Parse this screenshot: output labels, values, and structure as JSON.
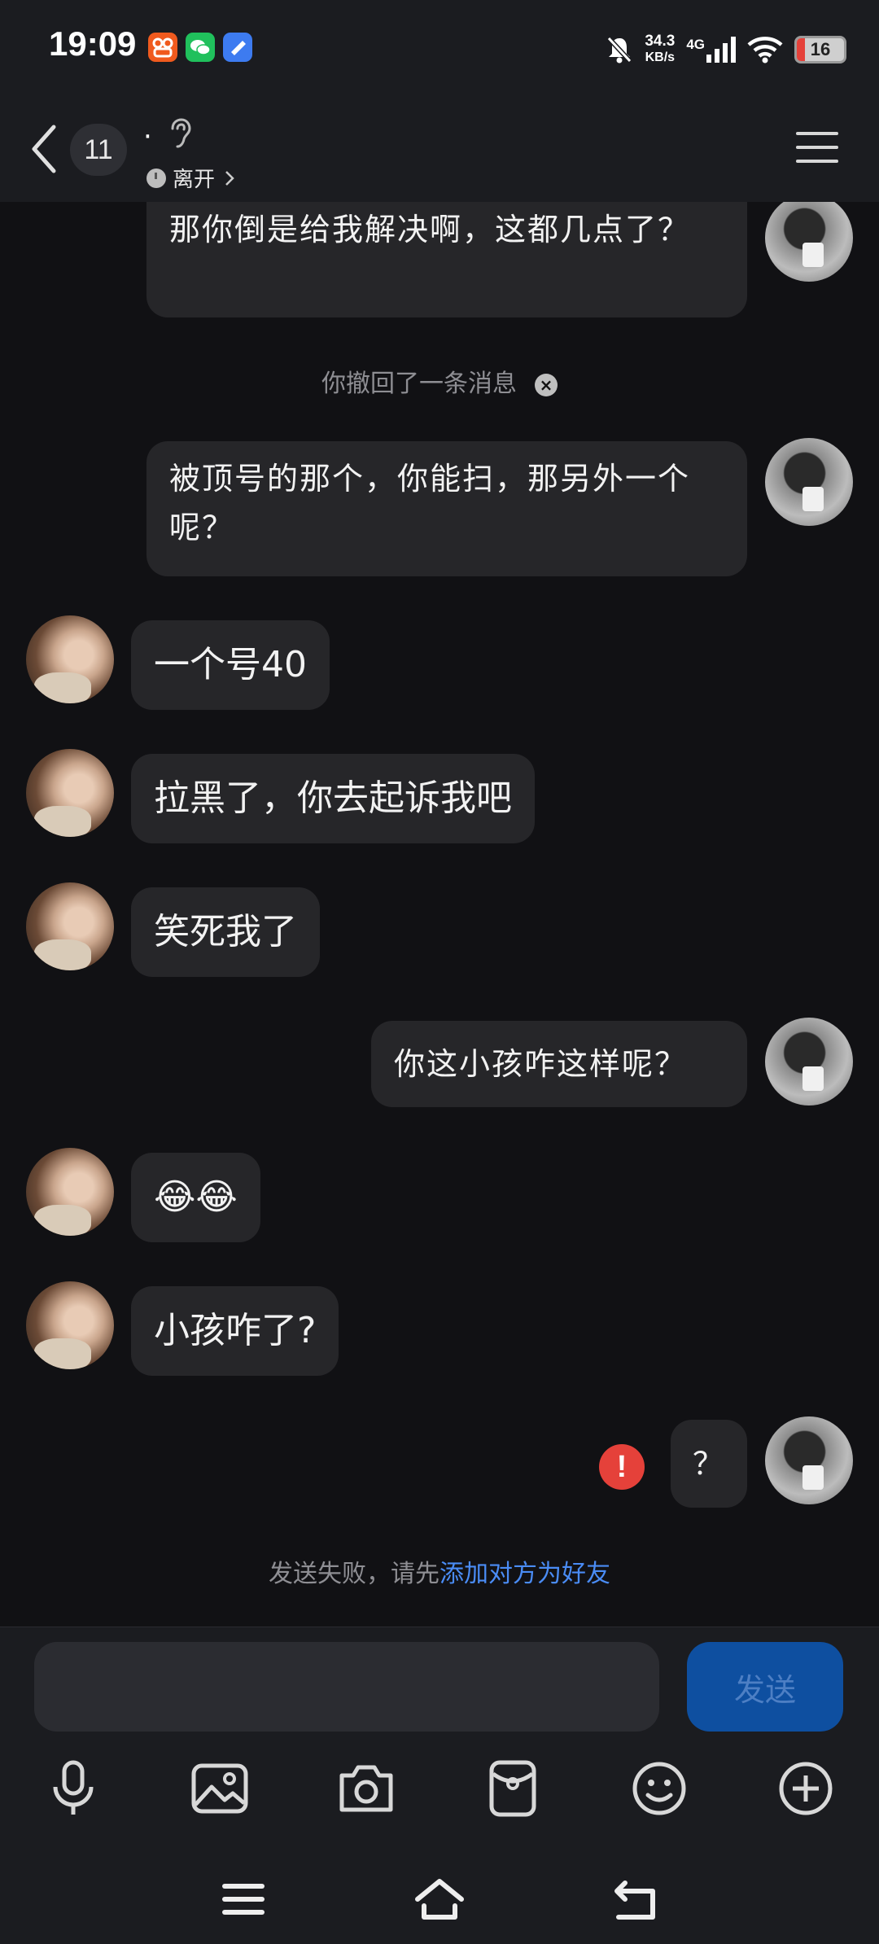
{
  "status_bar": {
    "time": "19:09",
    "net_speed": "34.3",
    "net_unit": "KB/s",
    "network": "4G",
    "battery": "16",
    "app_icons": [
      "app-orange-icon",
      "wechat-icon",
      "app-blue-icon"
    ]
  },
  "header": {
    "unread_count": "11",
    "contact_name": "·",
    "presence": "离开"
  },
  "messages": [
    {
      "side": "right",
      "text": "那你倒是给我解决啊，这都几点了？"
    },
    {
      "type": "recall",
      "text": "你撤回了一条消息"
    },
    {
      "side": "right",
      "text": "被顶号的那个，你能扫，那另外一个呢？"
    },
    {
      "side": "left",
      "text": "一个号40"
    },
    {
      "side": "left",
      "text": "拉黑了，你去起诉我吧"
    },
    {
      "side": "left",
      "text": "笑死我了"
    },
    {
      "side": "right",
      "text": "你这小孩咋这样呢？"
    },
    {
      "side": "left",
      "text": "😂😂"
    },
    {
      "side": "left",
      "text": "小孩咋了?"
    },
    {
      "side": "right",
      "text": "？",
      "failed": true
    }
  ],
  "fail_notice": {
    "text": "发送失败，请先",
    "link": "添加对方为好友"
  },
  "input": {
    "placeholder": "",
    "send_label": "发送"
  },
  "toolbar": [
    "microphone-icon",
    "image-icon",
    "camera-icon",
    "red-packet-icon",
    "emoji-icon",
    "plus-icon"
  ],
  "colors": {
    "background": "#111114",
    "bubble": "#262629",
    "send_button": "#0e4fa0",
    "link": "#4a8cf5",
    "error": "#e5413a"
  }
}
